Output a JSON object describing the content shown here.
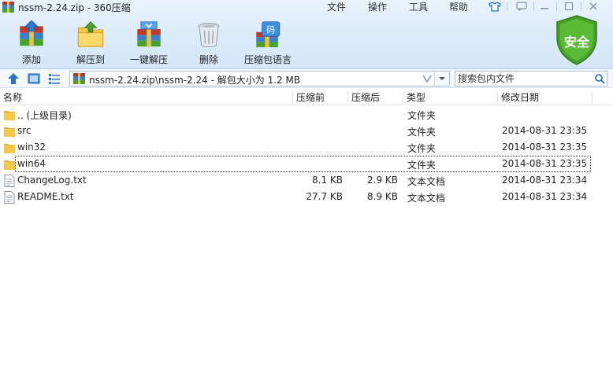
{
  "window": {
    "title": "nssm-2.24.zip - 360压缩",
    "menu": [
      "文件",
      "操作",
      "工具",
      "帮助"
    ]
  },
  "toolbar": {
    "add_label": "添加",
    "extract_to_label": "解压到",
    "one_click_label": "一键解压",
    "delete_label": "删除",
    "encoding_label": "压缩包语言",
    "security_label": "安全"
  },
  "address": {
    "path": "nssm-2.24.zip\\nssm-2.24 - 解包大小为 1.2 MB",
    "search_placeholder": "搜索包内文件"
  },
  "columns": {
    "name": "名称",
    "packed": "压缩前",
    "compressed": "压缩后",
    "type": "类型",
    "modified": "修改日期"
  },
  "files": [
    {
      "name": ".. (上级目录)",
      "packed": "",
      "compressed": "",
      "type": "文件夹",
      "modified": "",
      "kind": "folder"
    },
    {
      "name": "src",
      "packed": "",
      "compressed": "",
      "type": "文件夹",
      "modified": "2014-08-31 23:35",
      "kind": "folder"
    },
    {
      "name": "win32",
      "packed": "",
      "compressed": "",
      "type": "文件夹",
      "modified": "2014-08-31 23:35",
      "kind": "folder"
    },
    {
      "name": "win64",
      "packed": "",
      "compressed": "",
      "type": "文件夹",
      "modified": "2014-08-31 23:35",
      "kind": "folder",
      "selected": true
    },
    {
      "name": "ChangeLog.txt",
      "packed": "8.1 KB",
      "compressed": "2.9 KB",
      "type": "文本文档",
      "modified": "2014-08-31 23:34",
      "kind": "text"
    },
    {
      "name": "README.txt",
      "packed": "27.7 KB",
      "compressed": "8.9 KB",
      "type": "文本文档",
      "modified": "2014-08-31 23:34",
      "kind": "text"
    }
  ],
  "colors": {
    "accent_blue": "#2a73c8",
    "shield_green": "#4aa02c",
    "folder_yellow": "#f6c84a"
  }
}
